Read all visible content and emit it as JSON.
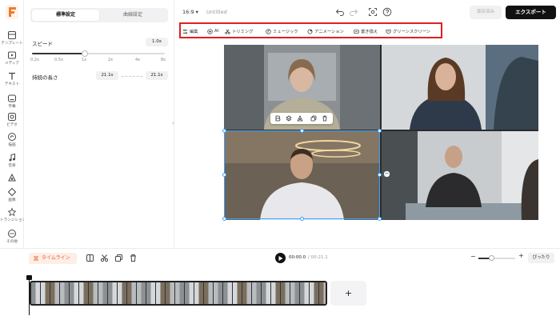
{
  "logo": {
    "letter": "F",
    "color": "#f07a2a"
  },
  "rail": {
    "items": [
      {
        "label": "テンプレート",
        "icon": "template-icon"
      },
      {
        "label": "メディア",
        "icon": "media-icon"
      },
      {
        "label": "テキスト",
        "icon": "text-icon"
      },
      {
        "label": "字幕",
        "icon": "subtitle-icon"
      },
      {
        "label": "ビデオ",
        "icon": "video-icon"
      },
      {
        "label": "描画",
        "icon": "draw-icon"
      },
      {
        "label": "音楽",
        "icon": "music-icon"
      },
      {
        "label": "",
        "icon": "element-icon"
      },
      {
        "label": "画像",
        "icon": "image-icon"
      },
      {
        "label": "トランジション",
        "icon": "transition-icon"
      },
      {
        "label": "その他",
        "icon": "more-icon"
      }
    ]
  },
  "panel": {
    "tabs": [
      "標準設定",
      "曲線設定"
    ],
    "speed_label": "スピード",
    "speed_value": "1.0x",
    "speed_ticks": [
      "0.2x",
      "0.5x",
      "1x",
      "2x",
      "4x",
      "8x"
    ],
    "speed_fraction": 0.4,
    "duration_label": "持続の長さ",
    "duration_from": "21.1s",
    "duration_to": "21.1s"
  },
  "topbar": {
    "aspect": "16:9",
    "title": "Untitled",
    "saved": "保存済み",
    "export": "エクスポート"
  },
  "toolbar": {
    "items": [
      "編集",
      "AI",
      "トリミング",
      "ミュージック",
      "アニメーション",
      "置き換え",
      "グリーンスクリーン"
    ],
    "highlight_color": "#e02020"
  },
  "timeline": {
    "label": "タイムライン",
    "current_time": "00:00.0",
    "total_time": "00:21.1",
    "zoom_fraction": 0.35,
    "fit_label": "ぴったり",
    "add_label": "+"
  }
}
